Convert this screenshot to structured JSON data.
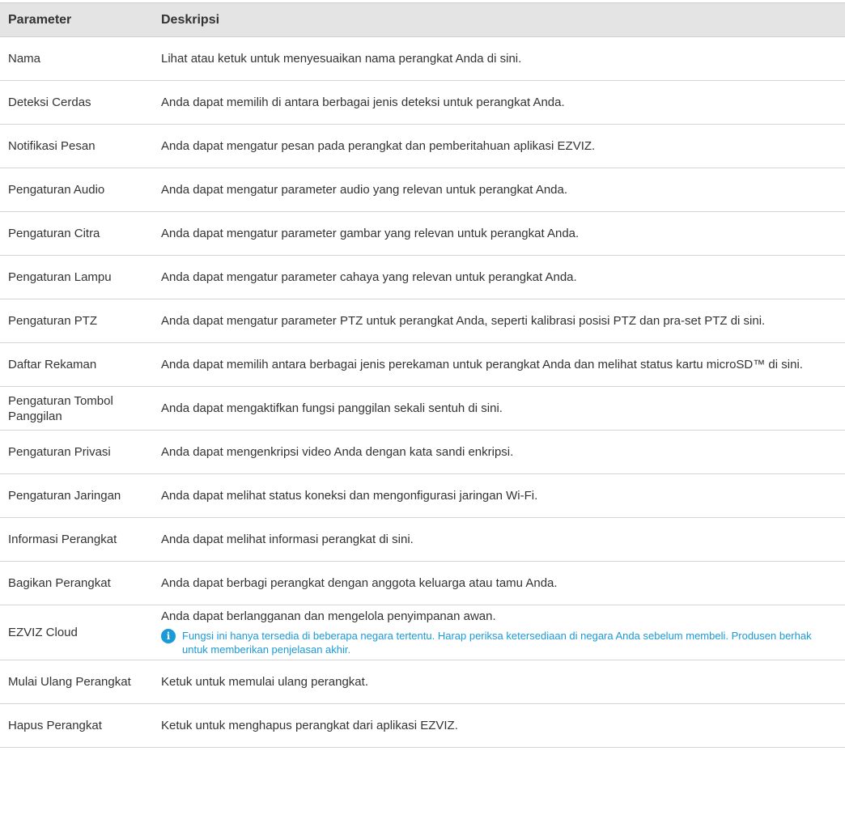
{
  "table": {
    "headers": [
      "Parameter",
      "Deskripsi"
    ],
    "rows": [
      {
        "param": "Nama",
        "desc": "Lihat atau ketuk untuk menyesuaikan nama perangkat Anda di sini."
      },
      {
        "param": "Deteksi Cerdas",
        "desc": "Anda dapat memilih di antara berbagai jenis deteksi untuk perangkat Anda."
      },
      {
        "param": "Notifikasi Pesan",
        "desc": "Anda dapat mengatur pesan pada perangkat dan pemberitahuan aplikasi EZVIZ."
      },
      {
        "param": "Pengaturan Audio",
        "desc": "Anda dapat mengatur parameter audio yang relevan untuk perangkat Anda."
      },
      {
        "param": "Pengaturan Citra",
        "desc": "Anda dapat mengatur parameter gambar yang relevan untuk perangkat Anda."
      },
      {
        "param": "Pengaturan Lampu",
        "desc": "Anda dapat mengatur parameter cahaya yang relevan untuk perangkat Anda."
      },
      {
        "param": "Pengaturan PTZ",
        "desc": "Anda dapat mengatur parameter PTZ untuk perangkat Anda, seperti kalibrasi posisi PTZ dan pra-set PTZ di sini."
      },
      {
        "param": "Daftar Rekaman",
        "desc": "Anda dapat memilih antara berbagai jenis perekaman untuk perangkat Anda dan melihat status kartu microSD™ di sini."
      },
      {
        "param": "Pengaturan Tombol Panggilan",
        "desc": "Anda dapat mengaktifkan fungsi panggilan sekali sentuh di sini."
      },
      {
        "param": "Pengaturan Privasi",
        "desc": "Anda dapat mengenkripsi video Anda dengan kata sandi enkripsi."
      },
      {
        "param": "Pengaturan Jaringan",
        "desc": "Anda dapat melihat status koneksi dan mengonfigurasi jaringan Wi-Fi."
      },
      {
        "param": "Informasi Perangkat",
        "desc": "Anda dapat melihat informasi perangkat di sini."
      },
      {
        "param": "Bagikan Perangkat",
        "desc": "Anda dapat berbagi perangkat dengan anggota keluarga atau tamu Anda."
      },
      {
        "param": "EZVIZ Cloud",
        "desc": "Anda dapat berlangganan dan mengelola penyimpanan awan.",
        "note": "Fungsi ini hanya tersedia di beberapa negara tertentu. Harap periksa ketersediaan di negara Anda sebelum membeli. Produsen berhak untuk memberikan penjelasan akhir."
      },
      {
        "param": "Mulai Ulang Perangkat",
        "desc": "Ketuk untuk memulai ulang perangkat."
      },
      {
        "param": "Hapus Perangkat",
        "desc": "Ketuk untuk menghapus perangkat dari aplikasi EZVIZ."
      }
    ]
  },
  "colors": {
    "note_text": "#1a9ad6",
    "header_bg": "#e4e4e4",
    "text": "#333333"
  },
  "icons": {
    "note_icon": "info-icon",
    "note_icon_glyph": "i"
  }
}
